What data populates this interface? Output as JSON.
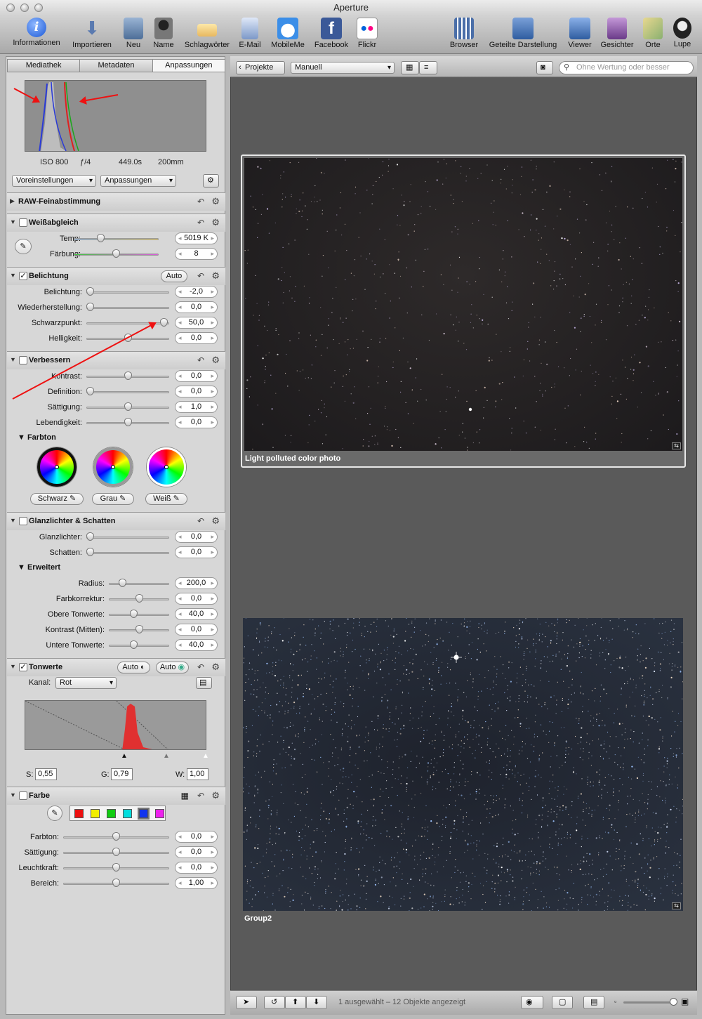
{
  "window": {
    "title": "Aperture"
  },
  "toolbar": {
    "items": [
      {
        "id": "info",
        "label": "Informationen",
        "icon": "info-icon"
      },
      {
        "id": "import",
        "label": "Importieren",
        "icon": "import-arrow-icon"
      },
      {
        "id": "new",
        "label": "Neu",
        "icon": "new-project-icon"
      },
      {
        "id": "name",
        "label": "Name",
        "icon": "person-silhouette-icon"
      },
      {
        "id": "keywords",
        "label": "Schlagwörter",
        "icon": "tag-icon"
      },
      {
        "id": "email",
        "label": "E-Mail",
        "icon": "email-stamp-icon"
      },
      {
        "id": "mobileme",
        "label": "MobileMe",
        "icon": "cloud-icon"
      },
      {
        "id": "facebook",
        "label": "Facebook",
        "icon": "facebook-icon"
      },
      {
        "id": "flickr",
        "label": "Flickr",
        "icon": "flickr-icon"
      },
      {
        "id": "browser",
        "label": "Browser",
        "icon": "grid-browser-icon"
      },
      {
        "id": "split",
        "label": "Geteilte Darstellung",
        "icon": "split-view-icon"
      },
      {
        "id": "viewer",
        "label": "Viewer",
        "icon": "viewer-icon"
      },
      {
        "id": "faces",
        "label": "Gesichter",
        "icon": "faces-icon"
      },
      {
        "id": "places",
        "label": "Orte",
        "icon": "map-icon"
      },
      {
        "id": "loupe",
        "label": "Lupe",
        "icon": "loupe-icon"
      }
    ]
  },
  "inspector": {
    "tabs": [
      "Mediathek",
      "Metadaten",
      "Anpassungen"
    ],
    "exif": {
      "iso": "ISO 800",
      "aperture": "ƒ/4",
      "shutter": "449.0s",
      "focal": "200mm"
    },
    "presets_label": "Voreinstellungen",
    "adjustments_label": "Anpassungen",
    "raw": {
      "title": "RAW-Feinabstimmung"
    },
    "white_balance": {
      "title": "Weißabgleich",
      "temp_label": "Temp:",
      "temp_value": "5019 K",
      "tint_label": "Färbung:",
      "tint_value": "8",
      "temp_level": 0.3,
      "tint_level": 0.5
    },
    "exposure": {
      "title": "Belichtung",
      "auto_label": "Auto",
      "rows": [
        {
          "label": "Belichtung:",
          "value": "-2,0",
          "level": 0.0
        },
        {
          "label": "Wiederherstellung:",
          "value": "0,0",
          "level": 0.0
        },
        {
          "label": "Schwarzpunkt:",
          "value": "50,0",
          "level": 0.98
        },
        {
          "label": "Helligkeit:",
          "value": "0,0",
          "level": 0.5
        }
      ]
    },
    "enhance": {
      "title": "Verbessern",
      "rows": [
        {
          "label": "Kontrast:",
          "value": "0,0",
          "level": 0.5
        },
        {
          "label": "Definition:",
          "value": "0,0",
          "level": 0.0
        },
        {
          "label": "Sättigung:",
          "value": "1,0",
          "level": 0.5
        },
        {
          "label": "Lebendigkeit:",
          "value": "0,0",
          "level": 0.5
        }
      ],
      "tint_title": "Farbton",
      "black_label": "Schwarz",
      "gray_label": "Grau",
      "white_label": "Weiß"
    },
    "highlights": {
      "title": "Glanzlichter & Schatten",
      "rows": [
        {
          "label": "Glanzlichter:",
          "value": "0,0",
          "level": 0.0
        },
        {
          "label": "Schatten:",
          "value": "0,0",
          "level": 0.0
        }
      ],
      "advanced_title": "Erweitert",
      "adv_rows": [
        {
          "label": "Radius:",
          "value": "200,0",
          "level": 0.18
        },
        {
          "label": "Farbkorrektur:",
          "value": "0,0",
          "level": 0.5
        },
        {
          "label": "Obere Tonwerte:",
          "value": "40,0",
          "level": 0.4
        },
        {
          "label": "Kontrast (Mitten):",
          "value": "0,0",
          "level": 0.5
        },
        {
          "label": "Untere Tonwerte:",
          "value": "40,0",
          "level": 0.4
        }
      ]
    },
    "levels": {
      "title": "Tonwerte",
      "auto1": "Auto",
      "auto2": "Auto",
      "channel_label": "Kanal:",
      "channel_value": "Rot",
      "s_label": "S:",
      "s_value": "0,55",
      "g_label": "G:",
      "g_value": "0,79",
      "w_label": "W:",
      "w_value": "1,00"
    },
    "color": {
      "title": "Farbe",
      "swatches": [
        "#ee1111",
        "#f2ee00",
        "#11cc11",
        "#00dddd",
        "#1133ee",
        "#ee22ee"
      ],
      "rows": [
        {
          "label": "Farbton:",
          "value": "0,0",
          "level": 0.5
        },
        {
          "label": "Sättigung:",
          "value": "0,0",
          "level": 0.5
        },
        {
          "label": "Leuchtkraft:",
          "value": "0,0",
          "level": 0.5
        },
        {
          "label": "Bereich:",
          "value": "1,00",
          "level": 0.5
        }
      ]
    }
  },
  "browser": {
    "projects_label": "Projekte",
    "sort_value": "Manuell",
    "search_placeholder": "Ohne Wertung oder besser",
    "photo1_caption": "Light polluted color photo",
    "photo2_caption": "Group2",
    "status_text": "1 ausgewählt – 12 Objekte angezeigt"
  }
}
